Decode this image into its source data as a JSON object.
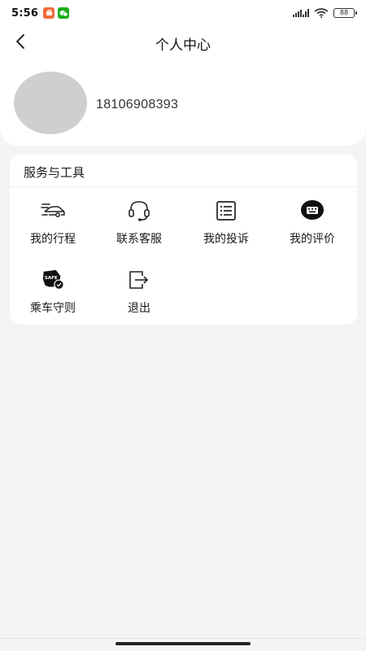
{
  "status_bar": {
    "time": "5:56",
    "battery": "88",
    "icons": [
      "notification-app-icon",
      "wechat-icon",
      "signal-icon",
      "wifi-icon",
      "battery-icon"
    ]
  },
  "header": {
    "title": "个人中心",
    "back_icon": "chevron-left-icon"
  },
  "profile": {
    "phone": "18106908393"
  },
  "services": {
    "title": "服务与工具",
    "items": [
      {
        "label": "我的行程",
        "icon": "car-speed-icon"
      },
      {
        "label": "联系客服",
        "icon": "headset-icon"
      },
      {
        "label": "我的投诉",
        "icon": "list-document-icon"
      },
      {
        "label": "我的评价",
        "icon": "chat-bubble-icon"
      },
      {
        "label": "乘车守则",
        "icon": "safe-shield-icon"
      },
      {
        "label": "退出",
        "icon": "logout-icon"
      }
    ]
  },
  "colors": {
    "background": "#f4f4f4",
    "card": "#ffffff",
    "avatar": "#cfcfcf",
    "text": "#1a1a1a",
    "app_badge_orange": "#f26b3a",
    "app_badge_green": "#1aad19"
  }
}
